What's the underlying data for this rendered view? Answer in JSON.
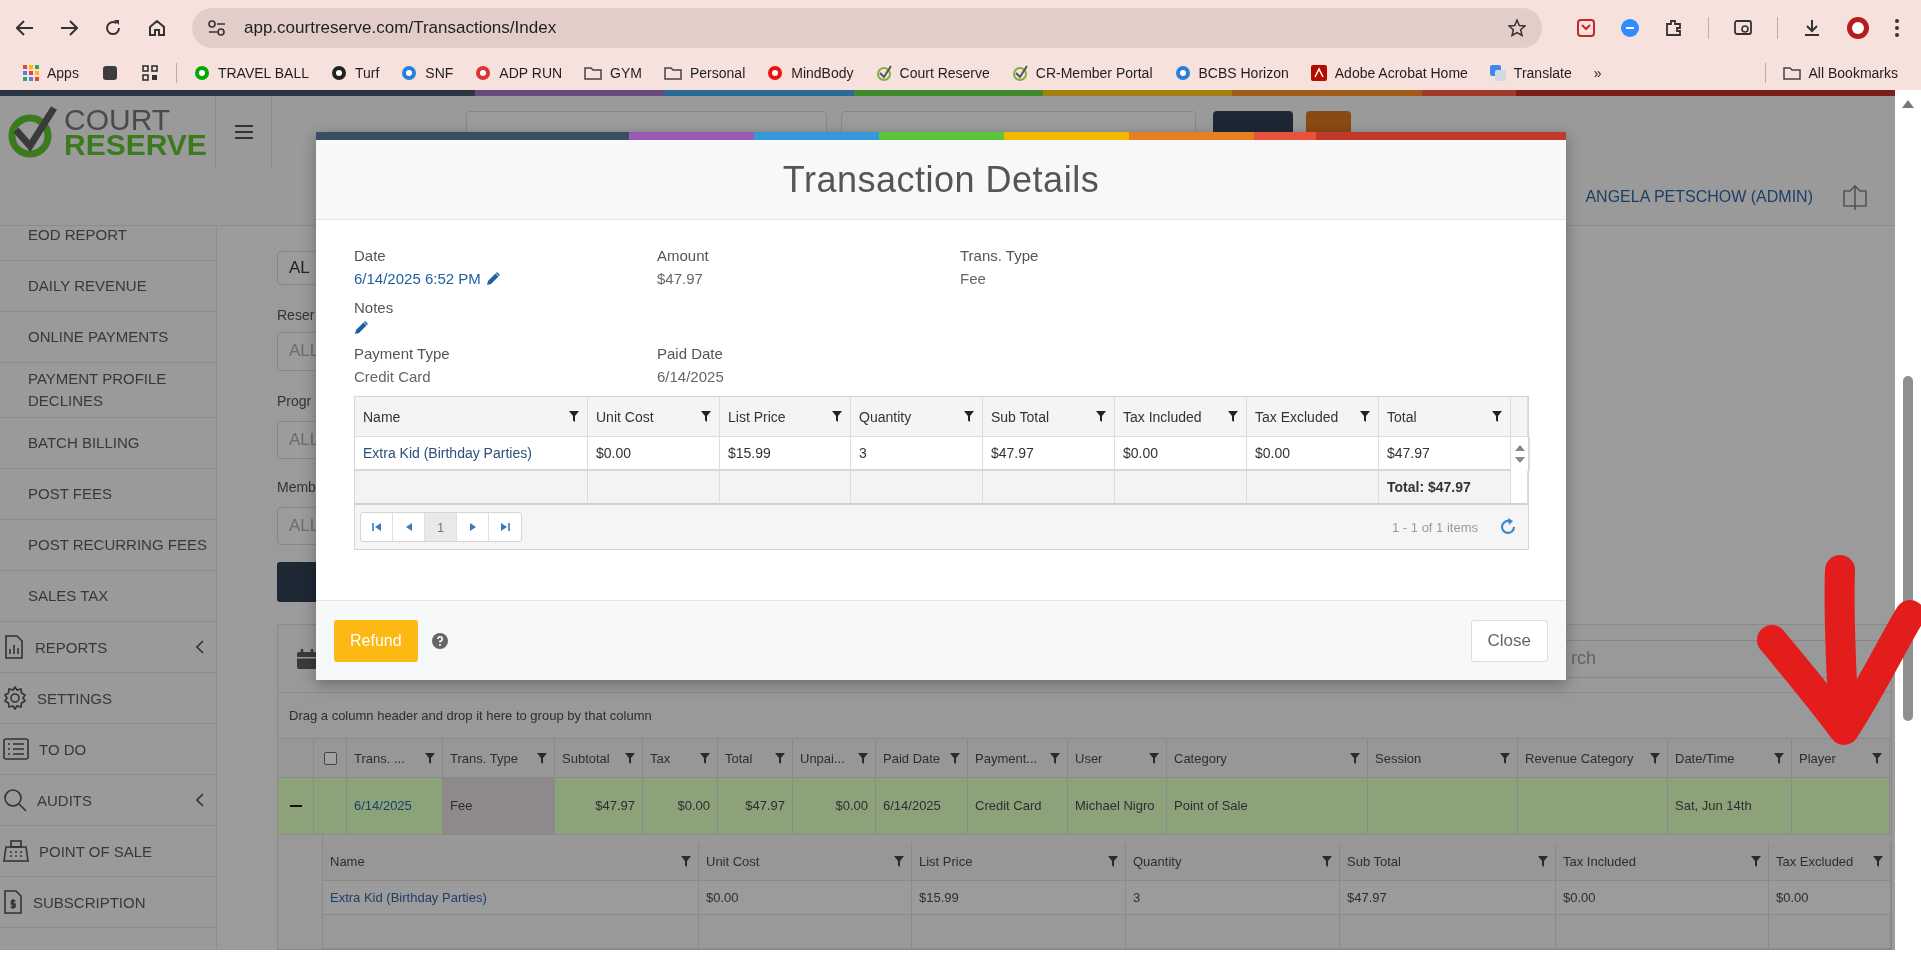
{
  "browser": {
    "url": "app.courtreserve.com/Transactions/Index",
    "bookmarks": [
      {
        "kind": "apps",
        "label": "Apps"
      },
      {
        "kind": "square"
      },
      {
        "kind": "grid"
      },
      {
        "kind": "separator"
      },
      {
        "kind": "site",
        "label": "TRAVEL BALL"
      },
      {
        "kind": "site",
        "label": "Turf"
      },
      {
        "kind": "site",
        "label": "SNF"
      },
      {
        "kind": "site",
        "label": "ADP RUN"
      },
      {
        "kind": "folder",
        "label": "GYM"
      },
      {
        "kind": "folder",
        "label": "Personal"
      },
      {
        "kind": "site",
        "label": "MindBody"
      },
      {
        "kind": "check",
        "label": "Court Reserve"
      },
      {
        "kind": "check",
        "label": "CR-Member Portal"
      },
      {
        "kind": "site",
        "label": "BCBS Horizon"
      },
      {
        "kind": "pdf",
        "label": "Adobe Acrobat Home"
      },
      {
        "kind": "translate",
        "label": "Translate"
      },
      {
        "kind": "more",
        "label": "»"
      },
      {
        "kind": "separator"
      },
      {
        "kind": "folder",
        "label": "All Bookmarks"
      }
    ]
  },
  "header": {
    "logo": {
      "top": "COURT",
      "bottom": "RESERVE"
    },
    "user": "ANGELA PETSCHOW (ADMIN)"
  },
  "sidebar": {
    "items": [
      {
        "kind": "sub",
        "label": "EOD REPORT"
      },
      {
        "kind": "sub",
        "label": "DAILY REVENUE"
      },
      {
        "kind": "sub",
        "label": "ONLINE PAYMENTS"
      },
      {
        "kind": "sub",
        "label": "PAYMENT PROFILE DECLINES"
      },
      {
        "kind": "sub",
        "label": "BATCH BILLING"
      },
      {
        "kind": "sub",
        "label": "POST FEES"
      },
      {
        "kind": "sub",
        "label": "POST RECURRING FEES"
      },
      {
        "kind": "sub",
        "label": "SALES TAX"
      },
      {
        "kind": "section",
        "label": "REPORTS",
        "submenu": true
      },
      {
        "kind": "section",
        "label": "SETTINGS",
        "submenu": false
      },
      {
        "kind": "section",
        "label": "TO DO",
        "submenu": false
      },
      {
        "kind": "section",
        "label": "AUDITS",
        "submenu": true
      },
      {
        "kind": "section",
        "label": "POINT OF SALE",
        "submenu": false
      },
      {
        "kind": "section",
        "label": "SUBSCRIPTION",
        "submenu": false
      }
    ]
  },
  "filters": [
    {
      "value": "AL"
    },
    {
      "label": "Reser",
      "placeholder": "ALL"
    },
    {
      "label": "Progr",
      "placeholder": "ALL"
    },
    {
      "label": "Memb",
      "placeholder": "ALL"
    }
  ],
  "grid": {
    "search_placeholder": "rch",
    "group_hint": "Drag a column header and drop it here to group by that column",
    "select_all_checked": false,
    "columns": [
      "",
      "",
      "Trans. ...",
      "Trans. Type",
      "Subtotal",
      "Tax",
      "Total",
      "Unpai...",
      "Paid Date",
      "Payment...",
      "User",
      "Category",
      "Session",
      "Revenue Category",
      "Date/Time",
      "Player"
    ],
    "rows": [
      {
        "expanded": true,
        "cells": [
          {
            "selected": false
          },
          {
            "selected": false
          },
          {
            "text": "6/14/2025",
            "selected": false
          },
          {
            "text": "Fee",
            "selected": true
          },
          {
            "text": "$47.97",
            "selected": false
          },
          {
            "text": "$0.00",
            "selected": false
          },
          {
            "text": "$47.97",
            "selected": false
          },
          {
            "text": "$0.00",
            "selected": false
          },
          {
            "text": "6/14/2025",
            "selected": false
          },
          {
            "text": "Credit Card",
            "selected": false
          },
          {
            "text": "Michael Nigro",
            "selected": false
          },
          {
            "text": "Point of Sale",
            "selected": false
          },
          {
            "selected": false
          },
          {
            "selected": false
          },
          {
            "text": "Sat, Jun 14th",
            "selected": false
          },
          {
            "selected": false
          }
        ]
      }
    ],
    "detail": {
      "columns": [
        "Name",
        "Unit Cost",
        "List Price",
        "Quantity",
        "Sub Total",
        "Tax Included",
        "Tax Excluded"
      ],
      "rows": [
        [
          "Extra Kid (Birthday Parties)",
          "$0.00",
          "$15.99",
          "3",
          "$47.97",
          "$0.00",
          "$0.00"
        ]
      ]
    }
  },
  "modal": {
    "title": "Transaction Details",
    "field_rows": [
      [
        {
          "kind": "editable",
          "label": "Date",
          "value": "6/14/2025 6:52 PM"
        },
        {
          "kind": "plain",
          "label": "Amount",
          "value": "$47.97"
        },
        {
          "kind": "plain",
          "label": "Trans. Type",
          "value": "Fee"
        }
      ],
      [
        {
          "kind": "edit-only",
          "label": "Notes"
        }
      ],
      [
        {
          "kind": "plain",
          "label": "Payment Type",
          "value": "Credit Card"
        },
        {
          "kind": "plain",
          "label": "Paid Date",
          "value": "6/14/2025"
        }
      ]
    ],
    "table": {
      "columns": [
        "Name",
        "Unit Cost",
        "List Price",
        "Quantity",
        "Sub Total",
        "Tax Included",
        "Tax Excluded",
        "Total"
      ],
      "rows": [
        [
          "Extra Kid (Birthday Parties)",
          "$0.00",
          "$15.99",
          "3",
          "$47.97",
          "$0.00",
          "$0.00",
          "$47.97"
        ]
      ],
      "footer_total": "Total: $47.97",
      "pages": [
        {
          "label": "1",
          "selected": true
        }
      ],
      "info": "1 - 1 of 1 items"
    },
    "refund": "Refund",
    "close": "Close"
  }
}
